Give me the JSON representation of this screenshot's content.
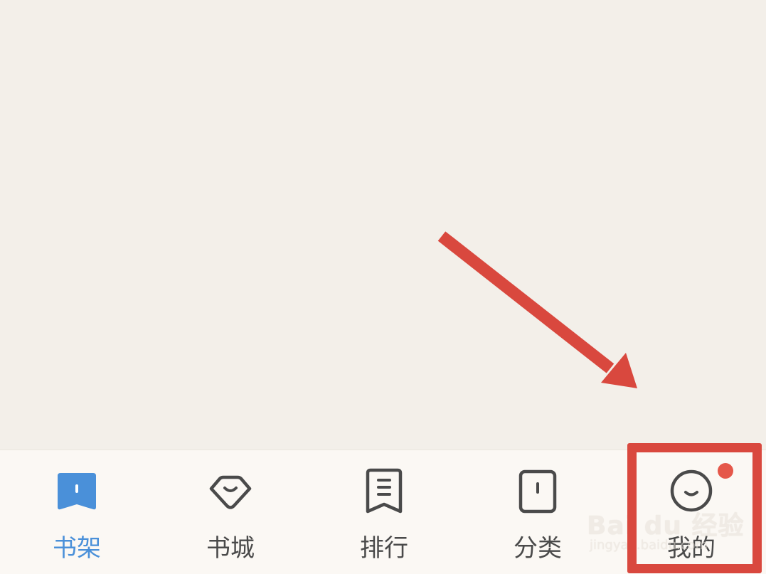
{
  "tabs": [
    {
      "label": "书架",
      "icon": "bookshelf-icon",
      "active": true
    },
    {
      "label": "书城",
      "icon": "bookstore-icon",
      "active": false
    },
    {
      "label": "排行",
      "icon": "ranking-icon",
      "active": false
    },
    {
      "label": "分类",
      "icon": "category-icon",
      "active": false
    },
    {
      "label": "我的",
      "icon": "profile-icon",
      "active": false
    }
  ],
  "colors": {
    "accent": "#4a90d9",
    "annotation": "#d9483e",
    "badge": "#e5574a",
    "icon_inactive": "#4a4a4a",
    "background": "#f3efe9",
    "tab_bar": "#fbf8f4"
  },
  "watermark": {
    "line1": "Bai du 经验",
    "line2": "jingyan.baidu.com"
  }
}
